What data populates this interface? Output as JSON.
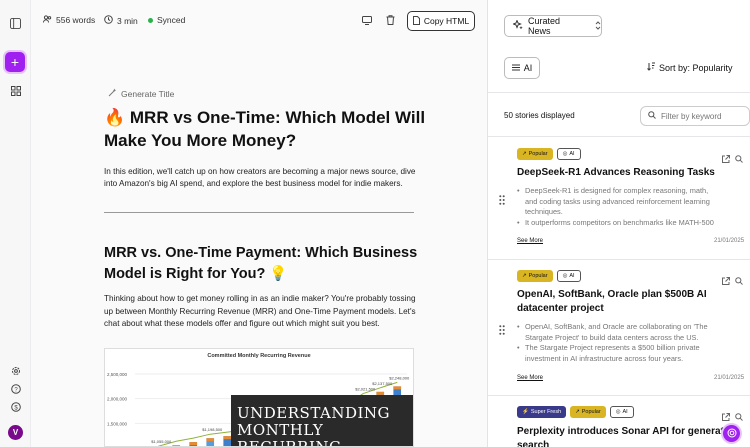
{
  "editor": {
    "stats": {
      "words": "556 words",
      "read_time": "3 min",
      "sync": "Synced"
    },
    "copy_label": "Copy HTML",
    "generate_title": "Generate Title",
    "title": "🔥 MRR vs One-Time: Which Model Will Make You More Money?",
    "intro": "In this edition, we'll catch up on how creators are becoming a major news source, dive into Amazon's big AI spend, and explore the best business model for indie makers.",
    "section_heading": "MRR vs. One-Time Payment: Which Business Model is Right for You? 💡",
    "section_para": "Thinking about how to get money rolling in as an indie maker? You're probably tossing up between Monthly Recurring Revenue (MRR) and One-Time Payment models. Let's chat about what these models offer and figure out which might suit you best.",
    "image_overlay": "UNDERSTANDING MONTHLY RECURRING"
  },
  "chart_data": {
    "type": "bar",
    "title": "Committed Monthly Recurring Revenue",
    "y_ticks": [
      "2,500,000",
      "2,000,000",
      "1,500,000"
    ],
    "point_labels": [
      "$1,055,000",
      "$1,198,500",
      "$1,281,000",
      "$1,672,000",
      "$2,021,500",
      "$2,137,500",
      "$2,248,000"
    ],
    "values": [
      820000,
      960000,
      1055000,
      1120000,
      1198500,
      1240000,
      1281000,
      1350000,
      1420000,
      1500000,
      1580000,
      1672000,
      1800000,
      2021500,
      2137500,
      2248000
    ],
    "ylim": [
      1000000,
      2600000
    ]
  },
  "news": {
    "source_label": "Curated News",
    "filter_chip": "AI",
    "sort_label": "Sort by: Popularity",
    "count": "50 stories displayed",
    "filter_placeholder": "Filter by keyword",
    "see_more": "See More",
    "stories": [
      {
        "badges": [
          "Popular",
          "AI"
        ],
        "title": "DeepSeek-R1 Advances Reasoning Tasks",
        "bullets": [
          "DeepSeek-R1 is designed for complex reasoning, math, and coding tasks using advanced reinforcement learning techniques.",
          "It outperforms competitors on benchmarks like MATH-500"
        ],
        "date": "21/01/2025"
      },
      {
        "badges": [
          "Popular",
          "AI"
        ],
        "title": "OpenAI, SoftBank, Oracle plan $500B AI datacenter project",
        "bullets": [
          "OpenAI, SoftBank, and Oracle are collaborating on 'The Stargate Project' to build data centers across the US.",
          "The Stargate Project represents a $500 billion private investment in AI infrastructure across four years."
        ],
        "date": "21/01/2025"
      },
      {
        "badges": [
          "Super Fresh",
          "Popular",
          "AI"
        ],
        "title": "Perplexity introduces Sonar API for generative search"
      }
    ]
  },
  "user": {
    "initial": "V"
  },
  "colors": {
    "accent": "#a020f0",
    "popular": "#d9b524",
    "fresh": "#3a3a8a",
    "synced": "#28b24a"
  }
}
